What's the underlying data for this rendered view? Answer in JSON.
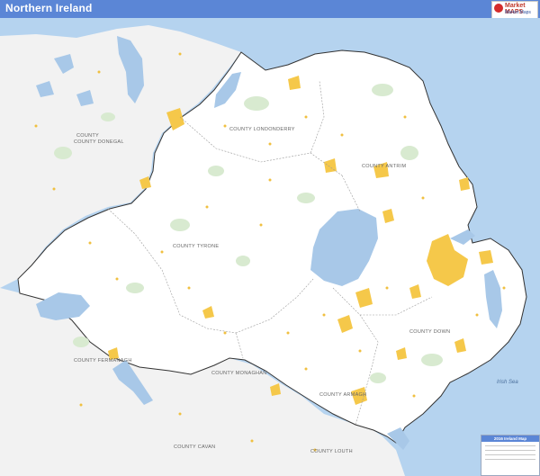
{
  "title": "Northern Ireland",
  "logo": {
    "brand": "Market MAPS",
    "sub": "Market Maps"
  },
  "colors": {
    "land": "#ffffff",
    "neighbour": "#f2f2f2",
    "water": "#a8c8e8",
    "sea": "#b5d3ef",
    "urban": "#f5c84a",
    "park": "#d8ead0",
    "border": "#333333",
    "title_bar": "#5b86d6"
  },
  "labels": {
    "donegal": "COUNTY DONEGAL",
    "londonderry": "COUNTY LONDONDERRY",
    "antrim": "COUNTY ANTRIM",
    "tyrone": "COUNTY TYRONE",
    "fermanagh": "COUNTY FERMANAGH",
    "monaghan": "COUNTY MONAGHAN",
    "armagh": "COUNTY ARMAGH",
    "down": "COUNTY DOWN",
    "cavan": "COUNTY CAVAN",
    "louth": "COUNTY LOUTH",
    "irish_sea": "Irish Sea"
  },
  "legend": {
    "title": "2016 Ireland Map"
  }
}
